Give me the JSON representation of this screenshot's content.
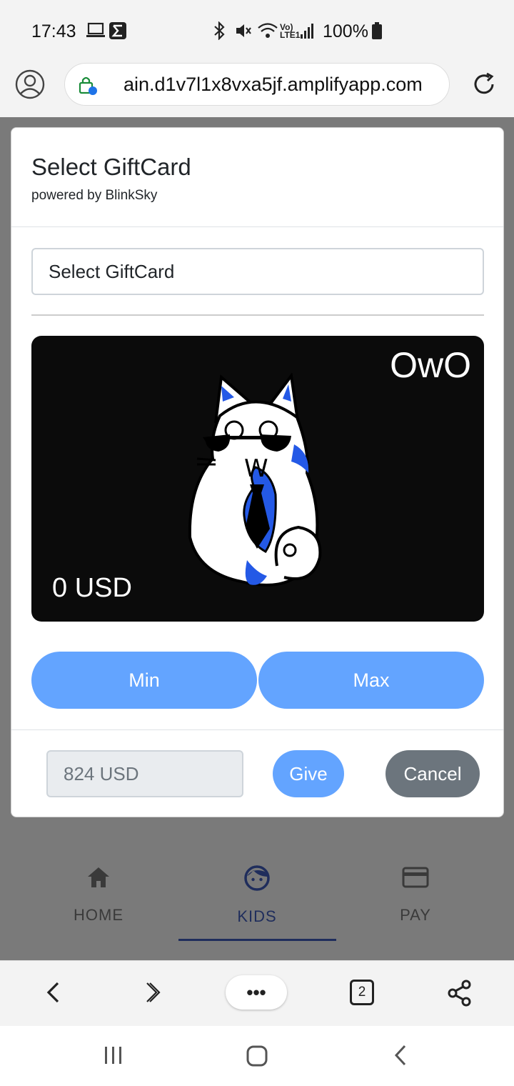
{
  "status_bar": {
    "time": "17:43",
    "battery": "100%",
    "network": "Vo) LTE1",
    "icons": [
      "laptop-icon",
      "sigma-icon",
      "bluetooth-icon",
      "mute-icon",
      "wifi-icon",
      "signal-icon",
      "battery-icon"
    ]
  },
  "browser": {
    "url": "ain.d1v7l1x8vxa5jf.amplifyapp.com",
    "tab_count": "2",
    "more_label": "•••"
  },
  "modal": {
    "title": "Select GiftCard",
    "subtitle": "powered by BlinkSky",
    "select_value": "Select GiftCard",
    "card": {
      "brand": "OwO",
      "amount": "0 USD",
      "art_letter": "W"
    },
    "min_label": "Min",
    "max_label": "Max",
    "amount_placeholder": "824 USD",
    "give_label": "Give",
    "cancel_label": "Cancel"
  },
  "app_nav": {
    "items": [
      {
        "label": "HOME",
        "icon": "home-icon"
      },
      {
        "label": "KIDS",
        "icon": "kid-face-icon",
        "active": true
      },
      {
        "label": "PAY",
        "icon": "credit-card-icon"
      }
    ]
  },
  "colors": {
    "accent": "#63a4ff",
    "cancel": "#6c757d",
    "nav_active": "#1f2d5c",
    "card_bg": "#0b0b0b"
  }
}
